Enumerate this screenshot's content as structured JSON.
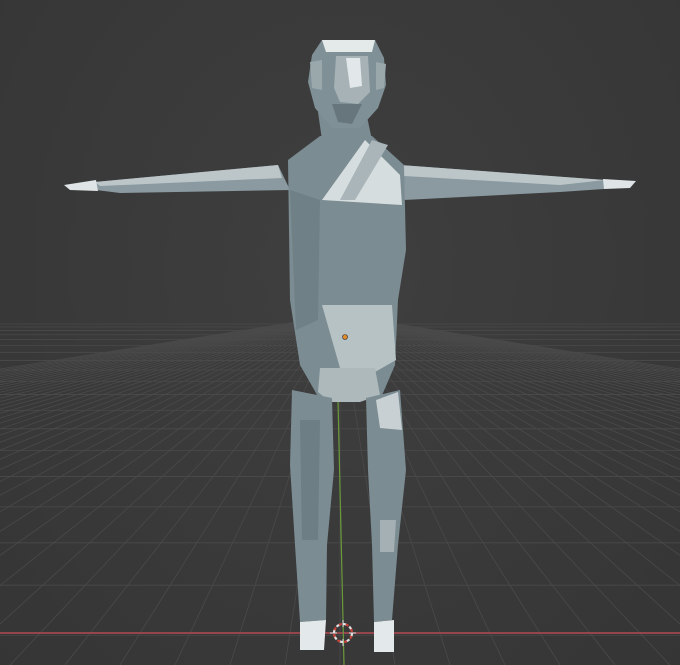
{
  "viewport": {
    "background": "#3a3a3a",
    "grid_color": "#4a4a4a",
    "x_axis_color": "#b24a52",
    "z_axis_color": "#6c9a3a",
    "model_color": "#7f8f95",
    "model_light_color": "#c9d1d4",
    "origin_color": "#e08a2a",
    "cursor_color": "#e0e0e0",
    "cursor_accent": "#c8423a"
  },
  "icons": {
    "cursor": "3d-cursor-icon",
    "origin": "object-origin-icon"
  }
}
